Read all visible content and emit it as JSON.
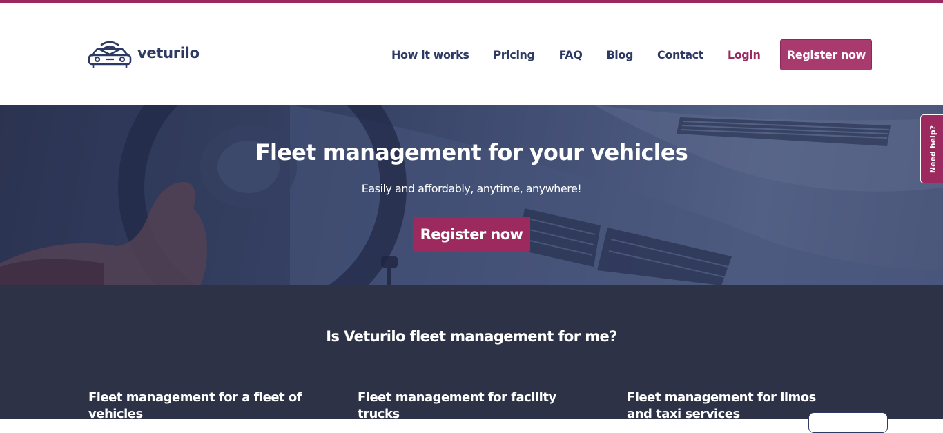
{
  "brand": {
    "name": "veturilo",
    "logo_icon": "car-wifi-icon",
    "accent_color": "#9c2a5e",
    "navy_color": "#2d3a63"
  },
  "nav": {
    "items": [
      "How it works",
      "Pricing",
      "FAQ",
      "Blog",
      "Contact"
    ],
    "login_label": "Login",
    "register_label": "Register now"
  },
  "hero": {
    "title": "Fleet management for your vehicles",
    "subtitle": "Easily and affordably, anytime, anywhere!",
    "cta_label": "Register now"
  },
  "help_tab": {
    "label": "Need help?"
  },
  "section_me": {
    "title": "Is Veturilo fleet management for me?",
    "cards": [
      {
        "title": "Fleet management for a fleet of vehicles"
      },
      {
        "title": "Fleet management for facility trucks"
      },
      {
        "title": "Fleet management for limos and taxi services"
      }
    ]
  }
}
